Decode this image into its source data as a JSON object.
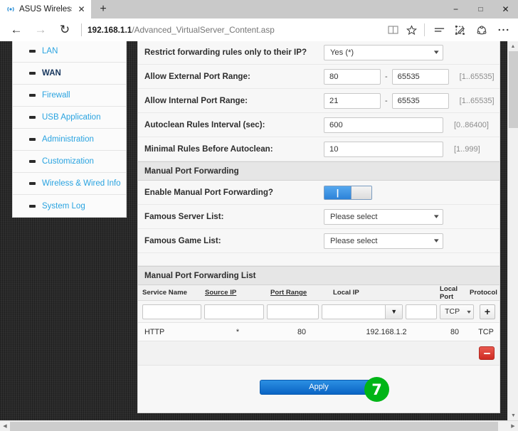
{
  "browser": {
    "tab": {
      "title": "ASUS Wireless Router -",
      "favicon": "wifi-icon",
      "close": "✕"
    },
    "newtab_label": "+",
    "window_controls": {
      "minimize": "−",
      "maximize": "□",
      "close": "✕"
    },
    "nav": {
      "back": "←",
      "forward": "→",
      "reload": "↻"
    },
    "address": {
      "host": "192.168.1.1",
      "path": "/Advanced_VirtualServer_Content.asp"
    },
    "toolbar_icons": [
      "reading-view-icon",
      "favorites-star-icon",
      "hub-icon",
      "web-notes-icon",
      "share-icon",
      "more-icon"
    ]
  },
  "sidebar": {
    "items": [
      {
        "label": "LAN",
        "active": false
      },
      {
        "label": "WAN",
        "active": true
      },
      {
        "label": "Firewall",
        "active": false
      },
      {
        "label": "USB Application",
        "active": false
      },
      {
        "label": "Administration",
        "active": false
      },
      {
        "label": "Customization",
        "active": false
      },
      {
        "label": "Wireless & Wired Info",
        "active": false
      },
      {
        "label": "System Log",
        "active": false
      }
    ]
  },
  "form": {
    "restrict": {
      "label": "Restrict forwarding rules only to their IP?",
      "value": "Yes (*)"
    },
    "external_port": {
      "label": "Allow External Port Range:",
      "from": "80",
      "to": "65535",
      "separator": "-",
      "hint": "[1..65535]"
    },
    "internal_port": {
      "label": "Allow Internal Port Range:",
      "from": "21",
      "to": "65535",
      "separator": "-",
      "hint": "[1..65535]"
    },
    "autoclean_interval": {
      "label": "Autoclean Rules Interval (sec):",
      "value": "600",
      "hint": "[0..86400]"
    },
    "minimal_rules": {
      "label": "Minimal Rules Before Autoclean:",
      "value": "10",
      "hint": "[1..999]"
    }
  },
  "manual_section": {
    "header": "Manual Port Forwarding",
    "enable": {
      "label": "Enable Manual Port Forwarding?",
      "state": "on",
      "on_mark": "|"
    },
    "famous_server": {
      "label": "Famous Server List:",
      "value": "Please select"
    },
    "famous_game": {
      "label": "Famous Game List:",
      "value": "Please select"
    }
  },
  "list_section": {
    "header": "Manual Port Forwarding List",
    "columns": [
      "Service Name",
      "Source IP",
      "Port Range",
      "Local IP",
      "Local Port",
      "Protocol"
    ],
    "underlined_columns": [
      "Source IP",
      "Port Range"
    ],
    "new_row": {
      "service_name": "",
      "source_ip": "",
      "port_range": "",
      "local_ip": "",
      "local_port": "",
      "protocol": "TCP",
      "add_label": "+"
    },
    "rows": [
      {
        "service_name": "HTTP",
        "source_ip": "*",
        "port_range": "80",
        "local_ip": "192.168.1.2",
        "local_port": "80",
        "protocol": "TCP",
        "selected": false
      }
    ],
    "delete_label": "−"
  },
  "apply": {
    "label": "Apply"
  },
  "callout": {
    "number": "7",
    "color": "#00b517"
  },
  "scrollbars": {
    "up": "▲",
    "down": "▼",
    "left": "◀",
    "right": "▶"
  }
}
